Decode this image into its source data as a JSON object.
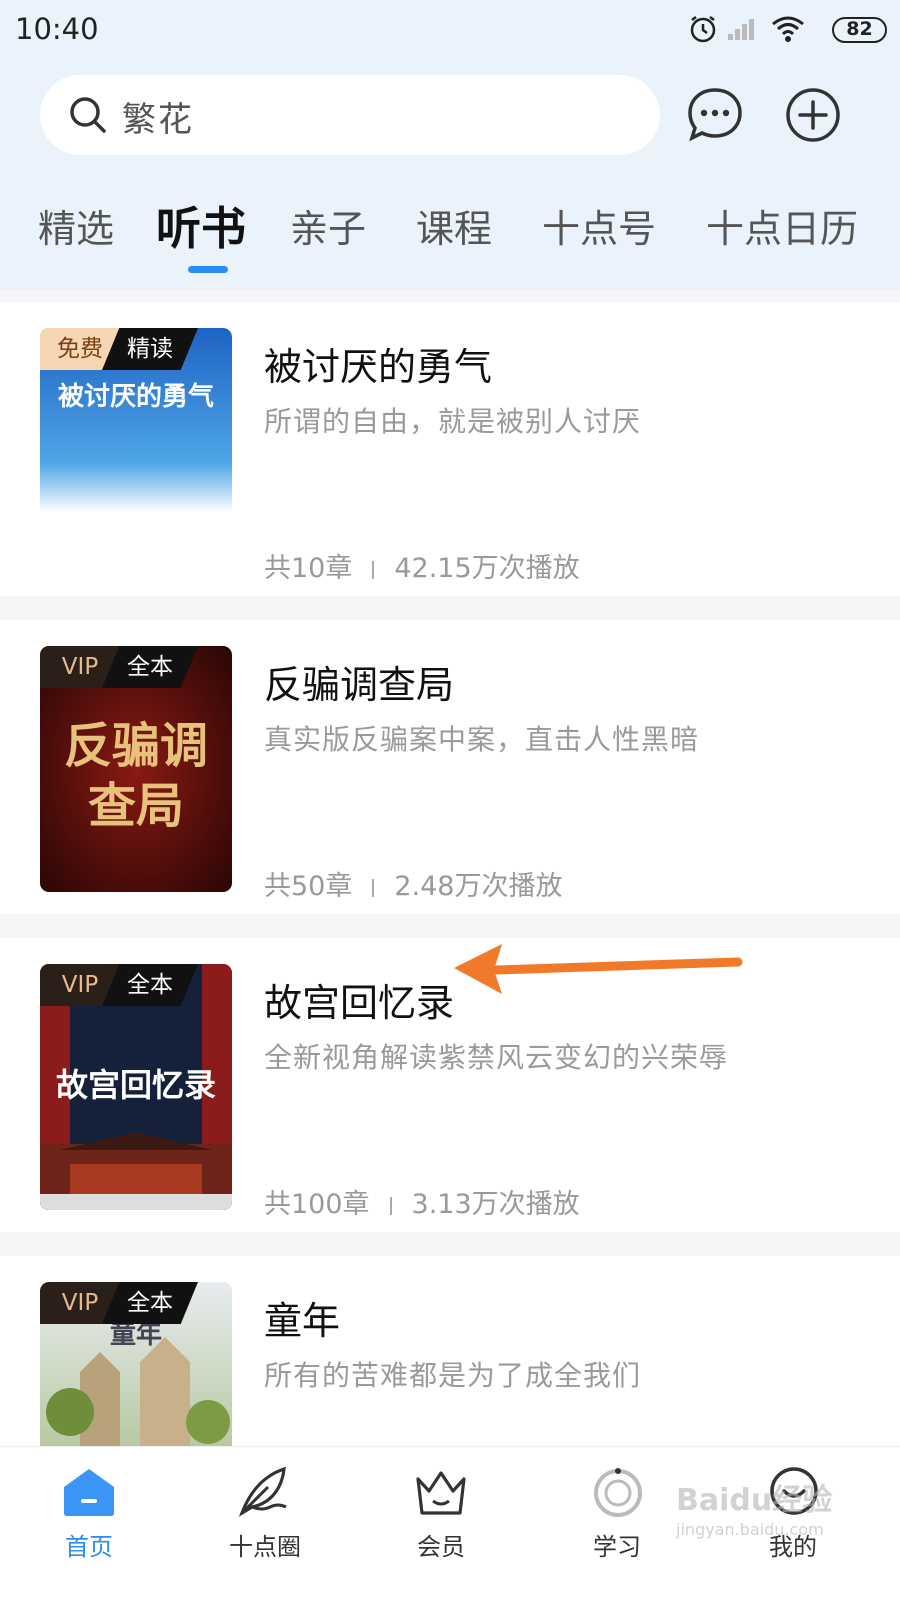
{
  "status_bar": {
    "time": "10:40",
    "battery": "82"
  },
  "search": {
    "query": "繁花"
  },
  "tabs": [
    {
      "label": "精选"
    },
    {
      "label": "听书",
      "active": true
    },
    {
      "label": "亲子"
    },
    {
      "label": "课程"
    },
    {
      "label": "十点号"
    },
    {
      "label": "十点日历"
    }
  ],
  "books": [
    {
      "tag_left": "免费",
      "tag_right": "精读",
      "cover_title": "被讨厌的勇气",
      "title": "被讨厌的勇气",
      "desc": "所谓的自由，就是被别人讨厌",
      "chapters": "共10章",
      "plays": "42.15万次播放"
    },
    {
      "tag_left": "VIP",
      "tag_right": "全本",
      "cover_title": "反骗调查局",
      "title": "反骗调查局",
      "desc": "真实版反骗案中案，直击人性黑暗",
      "chapters": "共50章",
      "plays": "2.48万次播放"
    },
    {
      "tag_left": "VIP",
      "tag_right": "全本",
      "cover_title": "故宫回忆录",
      "title": "故宫回忆录",
      "desc": "全新视角解读紫禁风云变幻的兴荣辱",
      "chapters": "共100章",
      "plays": "3.13万次播放"
    },
    {
      "tag_left": "VIP",
      "tag_right": "全本",
      "cover_title": "童年",
      "title": "童年",
      "desc": "所有的苦难都是为了成全我们"
    }
  ],
  "bottom_nav": [
    {
      "label": "首页",
      "active": true
    },
    {
      "label": "十点圈"
    },
    {
      "label": "会员"
    },
    {
      "label": "学习"
    },
    {
      "label": "我的"
    }
  ],
  "watermark": {
    "line1": "Baidu经验",
    "line2": "jingyan.baidu.com"
  },
  "colors": {
    "accent": "#2b8cf4",
    "arrow": "#f07a2a",
    "header_bg": "#eaf2fc"
  }
}
